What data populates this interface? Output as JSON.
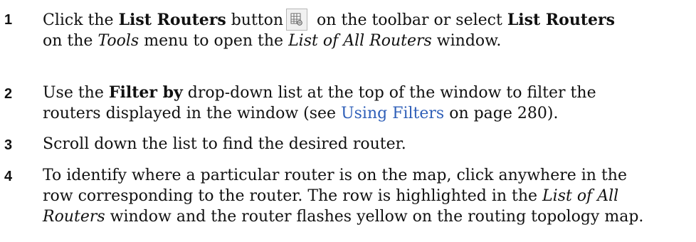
{
  "steps": [
    {
      "number": "1",
      "line1": {
        "t1": "Click the ",
        "b1": "List Routers",
        "t2": " button",
        "t3": " on the toolbar or select ",
        "b2": "List Routers"
      },
      "line2": {
        "t1": "on the ",
        "i1": "Tools",
        "t2": " menu to open the ",
        "i2": "List of All Routers",
        "t3": " window."
      },
      "icon": "list-routers-icon"
    },
    {
      "number": "2",
      "line1": {
        "t1": "Use the ",
        "b1": "Filter by",
        "t2": " drop-down list at the top of the window to filter the"
      },
      "line2": {
        "t1": "routers displayed in the window (see ",
        "link": "Using Filters",
        "t2": " on page 280)."
      }
    },
    {
      "number": "3",
      "line1": {
        "t1": "Scroll down the list to find the desired router."
      }
    },
    {
      "number": "4",
      "line1": {
        "t1": "To identify where a particular router is on the map, click anywhere in the"
      },
      "line2": {
        "t1": "row corresponding to the router. The row is highlighted in the ",
        "i1": "List of All"
      },
      "line3": {
        "i1": "Routers",
        "t1": " window and the router flashes yellow on the routing topology map."
      }
    }
  ],
  "colors": {
    "link": "#2f5fb8",
    "text": "#111111"
  }
}
